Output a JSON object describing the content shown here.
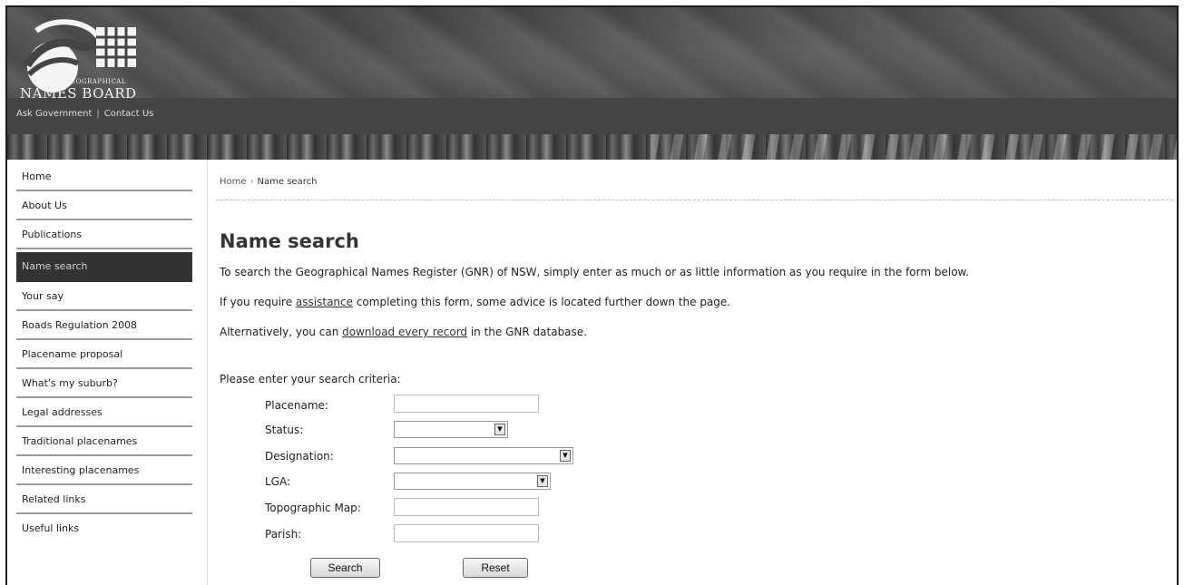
{
  "header": {
    "logo_small": "GEOGRAPHICAL",
    "logo_big": "NAMES BOARD",
    "links": [
      "Ask Government",
      "Contact Us"
    ]
  },
  "sidebar": {
    "items": [
      {
        "label": "Home"
      },
      {
        "label": "About Us"
      },
      {
        "label": "Publications"
      },
      {
        "label": "Name search",
        "active": true
      },
      {
        "label": "Your say"
      },
      {
        "label": "Roads Regulation 2008"
      },
      {
        "label": "Placename proposal"
      },
      {
        "label": "What's my suburb?"
      },
      {
        "label": "Legal addresses"
      },
      {
        "label": "Traditional placenames"
      },
      {
        "label": "Interesting placenames"
      },
      {
        "label": "Related links"
      },
      {
        "label": "Useful links"
      }
    ]
  },
  "breadcrumb": {
    "home": "Home",
    "separator": "›",
    "current": "Name search"
  },
  "main": {
    "title": "Name search",
    "para1": "To search the Geographical Names Register (GNR) of NSW, simply enter as much or as little information as you require in the form below.",
    "para2_before": "If you require ",
    "para2_link": "assistance",
    "para2_after": " completing this form, some advice is located further down the page.",
    "para3_before": "Alternatively, you can ",
    "para3_link": "download every record",
    "para3_after": " in the GNR database.",
    "criteria_label": "Please enter your search criteria:"
  },
  "form": {
    "placename_label": "Placename:",
    "placename_value": "",
    "status_label": "Status:",
    "status_value": "",
    "designation_label": "Designation:",
    "designation_value": "",
    "lga_label": "LGA:",
    "lga_value": "",
    "topomap_label": "Topographic Map:",
    "topomap_value": "",
    "parish_label": "Parish:",
    "parish_value": "",
    "search_button": "Search",
    "reset_button": "Reset"
  }
}
